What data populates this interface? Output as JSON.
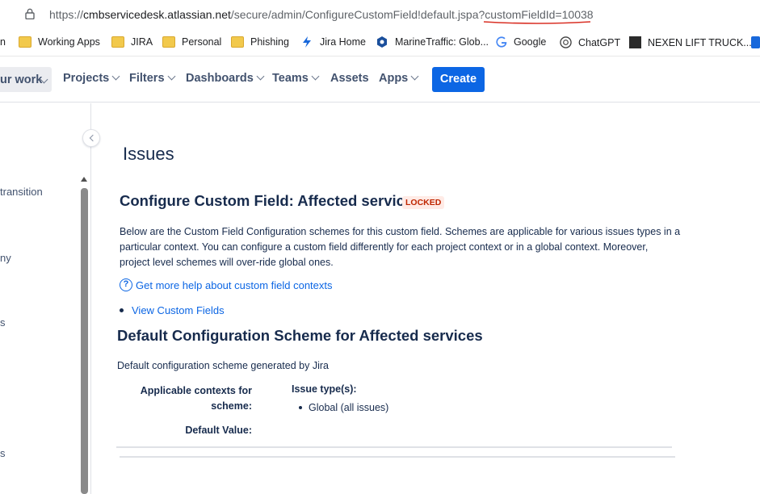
{
  "browser": {
    "url_prefix": "https://",
    "url_host": "cmbservicedesk.atlassian.net",
    "url_path": "/secure/admin/ConfigureCustomField!default.jspa?",
    "url_param": "customFieldId=10038"
  },
  "bookmarks": [
    {
      "label": "n",
      "icon": "truncated"
    },
    {
      "label": "Working Apps",
      "icon": "folder-icon"
    },
    {
      "label": "JIRA",
      "icon": "folder-icon"
    },
    {
      "label": "Personal",
      "icon": "folder-icon"
    },
    {
      "label": "Phishing",
      "icon": "folder-icon"
    },
    {
      "label": "Jira Home",
      "icon": "jira-icon"
    },
    {
      "label": "MarineTraffic: Glob...",
      "icon": "marinetraffic-icon"
    },
    {
      "label": "Google",
      "icon": "google-icon"
    },
    {
      "label": "ChatGPT",
      "icon": "chatgpt-icon"
    },
    {
      "label": "NEXEN LIFT TRUCK...",
      "icon": "nexen-icon"
    }
  ],
  "nav": {
    "your_work": "ur work",
    "projects": "Projects",
    "filters": "Filters",
    "dashboards": "Dashboards",
    "teams": "Teams",
    "assets": "Assets",
    "apps": "Apps",
    "create": "Create"
  },
  "sidebar": {
    "items": [
      "transition",
      "ny",
      "s",
      "s"
    ]
  },
  "main": {
    "page_title": "Issues",
    "section_title": "Configure Custom Field: Affected services",
    "locked_badge": "LOCKED",
    "description": "Below are the Custom Field Configuration schemes for this custom field. Schemes are applicable for various issues types in a particular context. You can configure a custom field differently for each project context or in a global context. Moreover, project level schemes will over-ride global ones.",
    "help_link": "Get more help about custom field contexts",
    "view_link": "View Custom Fields",
    "default_title": "Default Configuration Scheme for Affected services",
    "default_desc": "Default configuration scheme generated by Jira",
    "applicable_label": "Applicable contexts for scheme:",
    "issue_types_label": "Issue type(s):",
    "issue_types": [
      "Global (all issues)"
    ],
    "default_value_label": "Default Value:"
  },
  "colors": {
    "primary": "#0c66e4",
    "locked_bg": "#ffebe6",
    "locked_text": "#bf2600",
    "annotation": "#d93025"
  }
}
